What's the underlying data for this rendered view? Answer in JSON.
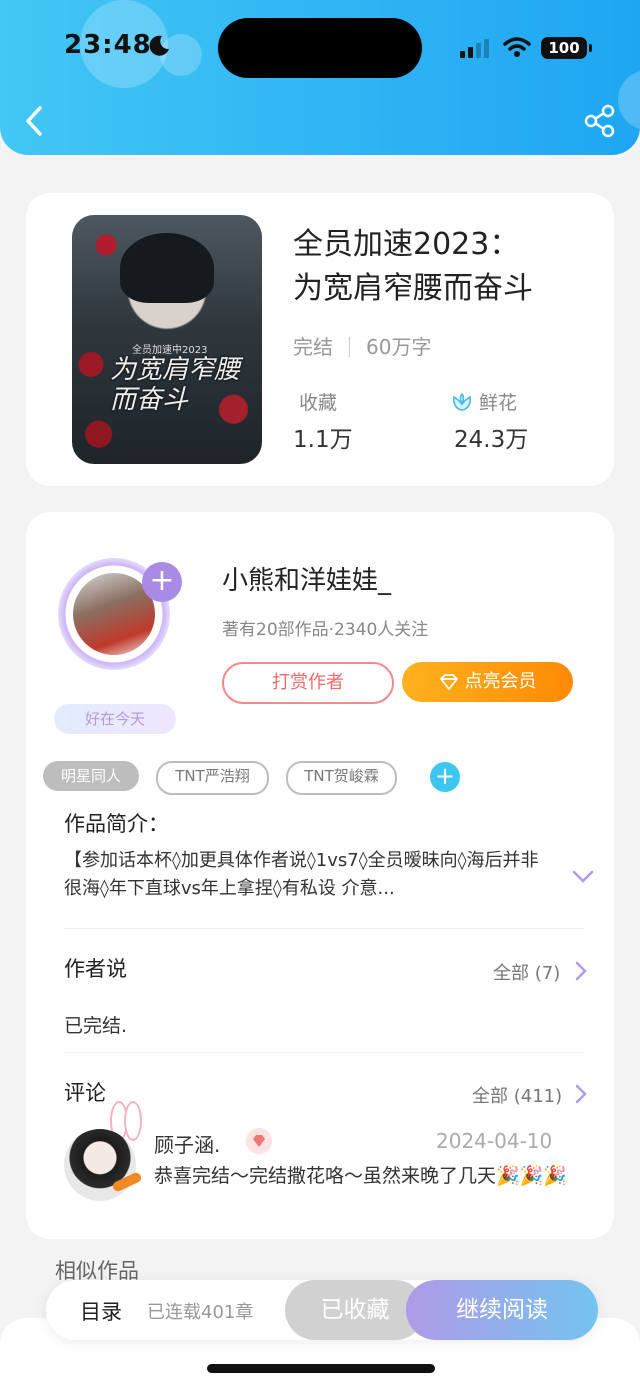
{
  "status_bar": {
    "time": "23:48",
    "battery": "100"
  },
  "book": {
    "title_line1": "全员加速2023：",
    "title_line2": "为宽肩窄腰而奋斗",
    "status": "完结",
    "word_count": "60万字",
    "favorites_label": "收藏",
    "favorites_value": "1.1万",
    "flowers_label": "鲜花",
    "flowers_value": "24.3万",
    "cover_small": "全员加速中2023",
    "cover_title": "为宽肩窄腰而奋斗"
  },
  "author": {
    "name": "小熊和洋娃娃_",
    "stats": "著有20部作品·2340人关注",
    "mood": "好在今天",
    "tip_label": "打赏作者",
    "vip_label": "点亮会员"
  },
  "tags": [
    "明星同人",
    "TNT严浩翔",
    "TNT贺峻霖"
  ],
  "intro": {
    "title": "作品简介：",
    "text": "【参加话本杯◊加更具体作者说◊1vs7◊全员暧昧向◊海后并非很海◊年下直球vs年上拿捏◊有私设 介意..."
  },
  "author_said": {
    "title": "作者说",
    "more": "全部 (7)",
    "text": "已完结."
  },
  "comments": {
    "title": "评论",
    "more": "全部 (411)",
    "items": [
      {
        "user": "顾子涵.",
        "date": "2024-04-10",
        "text": "恭喜完结～完结撒花咯～虽然来晚了几天🎉🎉🎉"
      }
    ]
  },
  "similar_title": "相似作品",
  "bottom_bar": {
    "toc": "目录",
    "serial": "已连载401章",
    "saved": "已收藏",
    "continue": "继续阅读"
  },
  "colors": {
    "header": "#2fb4f4",
    "accent_purple": "#a98be6",
    "vip_orange": "#ff8a05"
  }
}
